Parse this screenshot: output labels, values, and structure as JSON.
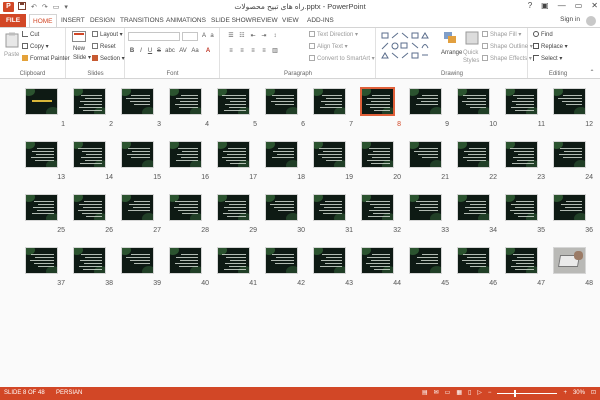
{
  "titlebar": {
    "app_icon": "P",
    "title": "راه های تبیح محصولات.pptx - PowerPoint",
    "help": "?",
    "minimize": "—",
    "restore": "▭",
    "close": "✕"
  },
  "tabs": [
    "FILE",
    "HOME",
    "INSERT",
    "DESIGN",
    "TRANSITIONS",
    "ANIMATIONS",
    "SLIDE SHOW",
    "REVIEW",
    "VIEW",
    "ADD-INS"
  ],
  "account": {
    "signin": "Sign in"
  },
  "ribbon": {
    "clipboard": {
      "paste": "Paste",
      "cut": "Cut",
      "copy": "Copy",
      "format_painter": "Format Painter",
      "label": "Clipboard"
    },
    "slides": {
      "new_slide": "New",
      "new_slide2": "Slide",
      "layout": "Layout",
      "reset": "Reset",
      "section": "Section",
      "label": "Slides"
    },
    "font": {
      "label": "Font",
      "bold": "B",
      "italic": "I",
      "underline": "U",
      "strike": "S",
      "shadow": "abc",
      "spacing": "AV",
      "case": "Aa",
      "font_color": "A"
    },
    "paragraph": {
      "text_direction": "Text Direction",
      "align_text": "Align Text",
      "convert_smartart": "Convert to SmartArt",
      "label": "Paragraph"
    },
    "drawing": {
      "arrange": "Arrange",
      "quick_styles": "Quick",
      "quick_styles2": "Styles",
      "shape_fill": "Shape Fill",
      "shape_outline": "Shape Outline",
      "shape_effects": "Shape Effects",
      "label": "Drawing"
    },
    "editing": {
      "find": "Find",
      "replace": "Replace",
      "select": "Select",
      "label": "Editing"
    }
  },
  "slides": [
    {
      "n": "12"
    },
    {
      "n": "11"
    },
    {
      "n": "10"
    },
    {
      "n": "9"
    },
    {
      "n": "8",
      "selected": true
    },
    {
      "n": "7"
    },
    {
      "n": "6"
    },
    {
      "n": "5"
    },
    {
      "n": "4"
    },
    {
      "n": "3"
    },
    {
      "n": "2"
    },
    {
      "n": "1"
    },
    {
      "n": "24"
    },
    {
      "n": "23"
    },
    {
      "n": "22"
    },
    {
      "n": "21"
    },
    {
      "n": "20"
    },
    {
      "n": "19"
    },
    {
      "n": "18"
    },
    {
      "n": "17"
    },
    {
      "n": "16"
    },
    {
      "n": "15"
    },
    {
      "n": "14"
    },
    {
      "n": "13"
    },
    {
      "n": "36"
    },
    {
      "n": "35"
    },
    {
      "n": "34"
    },
    {
      "n": "33"
    },
    {
      "n": "32"
    },
    {
      "n": "31"
    },
    {
      "n": "30"
    },
    {
      "n": "29"
    },
    {
      "n": "28"
    },
    {
      "n": "27"
    },
    {
      "n": "26"
    },
    {
      "n": "25"
    },
    {
      "n": "48",
      "photo": true
    },
    {
      "n": "47"
    },
    {
      "n": "46"
    },
    {
      "n": "45"
    },
    {
      "n": "44"
    },
    {
      "n": "43"
    },
    {
      "n": "42"
    },
    {
      "n": "41"
    },
    {
      "n": "40"
    },
    {
      "n": "39"
    },
    {
      "n": "38"
    },
    {
      "n": "37"
    }
  ],
  "status": {
    "slide_info": "SLIDE 8 OF 48",
    "language": "PERSIAN",
    "zoom_minus": "−",
    "zoom_plus": "+",
    "zoom": "30%",
    "zoom_level": 0.3
  },
  "colors": {
    "accent": "#d24726",
    "selection": "#e0603a",
    "slide_bg": "#0e1a14"
  }
}
